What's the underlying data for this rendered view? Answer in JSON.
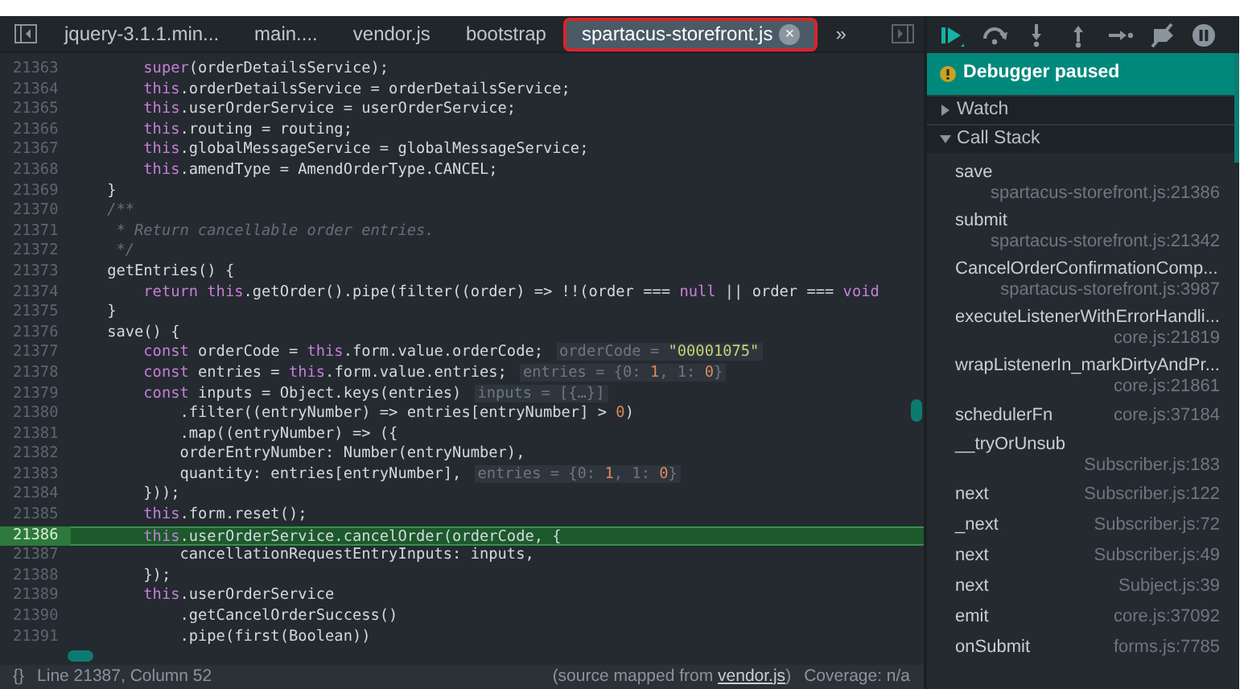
{
  "tabs": [
    {
      "label": "jquery-3.1.1.min...",
      "selected": false
    },
    {
      "label": "main....",
      "selected": false
    },
    {
      "label": "vendor.js",
      "selected": false
    },
    {
      "label": "bootstrap",
      "selected": false
    },
    {
      "label": "spartacus-storefront.js",
      "selected": true,
      "close": "×"
    }
  ],
  "tabs_overflow": "»",
  "code": {
    "lines": [
      {
        "number": "21363",
        "highlighted": false,
        "segments": [
          {
            "kind": "kw",
            "text": "        super"
          },
          {
            "kind": "plain",
            "text": "(orderDetailsService);"
          }
        ]
      },
      {
        "number": "21364",
        "highlighted": false,
        "segments": [
          {
            "kind": "kw",
            "text": "        this"
          },
          {
            "kind": "plain",
            "text": ".orderDetailsService = orderDetailsService;"
          }
        ]
      },
      {
        "number": "21365",
        "highlighted": false,
        "segments": [
          {
            "kind": "kw",
            "text": "        this"
          },
          {
            "kind": "plain",
            "text": ".userOrderService = userOrderService;"
          }
        ]
      },
      {
        "number": "21366",
        "highlighted": false,
        "segments": [
          {
            "kind": "kw",
            "text": "        this"
          },
          {
            "kind": "plain",
            "text": ".routing = routing;"
          }
        ]
      },
      {
        "number": "21367",
        "highlighted": false,
        "segments": [
          {
            "kind": "kw",
            "text": "        this"
          },
          {
            "kind": "plain",
            "text": ".globalMessageService = globalMessageService;"
          }
        ]
      },
      {
        "number": "21368",
        "highlighted": false,
        "segments": [
          {
            "kind": "kw",
            "text": "        this"
          },
          {
            "kind": "plain",
            "text": ".amendType = AmendOrderType.CANCEL;"
          }
        ]
      },
      {
        "number": "21369",
        "highlighted": false,
        "segments": [
          {
            "kind": "plain",
            "text": "    }"
          }
        ]
      },
      {
        "number": "21370",
        "highlighted": false,
        "segments": [
          {
            "kind": "comment",
            "text": "    /**"
          }
        ]
      },
      {
        "number": "21371",
        "highlighted": false,
        "segments": [
          {
            "kind": "comment",
            "text": "     * Return cancellable order entries."
          }
        ]
      },
      {
        "number": "21372",
        "highlighted": false,
        "segments": [
          {
            "kind": "comment",
            "text": "     */"
          }
        ]
      },
      {
        "number": "21373",
        "highlighted": false,
        "segments": [
          {
            "kind": "plain",
            "text": "    getEntries() {"
          }
        ]
      },
      {
        "number": "21374",
        "highlighted": false,
        "segments": [
          {
            "kind": "kw",
            "text": "        return this"
          },
          {
            "kind": "plain",
            "text": ".getOrder().pipe(filter((order) => !!(order === "
          },
          {
            "kind": "kw",
            "text": "null"
          },
          {
            "kind": "plain",
            "text": " || order === "
          },
          {
            "kind": "kw",
            "text": "void"
          }
        ]
      },
      {
        "number": "21375",
        "highlighted": false,
        "segments": [
          {
            "kind": "plain",
            "text": "    }"
          }
        ]
      },
      {
        "number": "21376",
        "highlighted": false,
        "segments": [
          {
            "kind": "plain",
            "text": "    save() {"
          }
        ]
      },
      {
        "number": "21377",
        "highlighted": false,
        "segments": [
          {
            "kind": "kw",
            "text": "        const"
          },
          {
            "kind": "plain",
            "text": " orderCode = "
          },
          {
            "kind": "kw",
            "text": "this"
          },
          {
            "kind": "plain",
            "text": ".form.value.orderCode;"
          }
        ],
        "inline_value": [
          {
            "kind": "hint",
            "text": "orderCode = "
          },
          {
            "kind": "str",
            "text": "\"00001075\""
          }
        ]
      },
      {
        "number": "21378",
        "highlighted": false,
        "segments": [
          {
            "kind": "kw",
            "text": "        const"
          },
          {
            "kind": "plain",
            "text": " entries = "
          },
          {
            "kind": "kw",
            "text": "this"
          },
          {
            "kind": "plain",
            "text": ".form.value.entries;"
          }
        ],
        "inline_value": [
          {
            "kind": "hint",
            "text": "entries = {0: "
          },
          {
            "kind": "num",
            "text": "1"
          },
          {
            "kind": "hint",
            "text": ", 1: "
          },
          {
            "kind": "num",
            "text": "0"
          },
          {
            "kind": "hint",
            "text": "}"
          }
        ]
      },
      {
        "number": "21379",
        "highlighted": false,
        "segments": [
          {
            "kind": "kw",
            "text": "        const"
          },
          {
            "kind": "plain",
            "text": " inputs = Object.keys(entries)"
          }
        ],
        "inline_value": [
          {
            "kind": "hint",
            "text": "inputs = [{…}]"
          }
        ]
      },
      {
        "number": "21380",
        "highlighted": false,
        "segments": [
          {
            "kind": "plain",
            "text": "            .filter((entryNumber) => entries[entryNumber] > "
          },
          {
            "kind": "num",
            "text": "0"
          },
          {
            "kind": "plain",
            "text": ")"
          }
        ]
      },
      {
        "number": "21381",
        "highlighted": false,
        "segments": [
          {
            "kind": "plain",
            "text": "            .map((entryNumber) => ({"
          }
        ]
      },
      {
        "number": "21382",
        "highlighted": false,
        "segments": [
          {
            "kind": "plain",
            "text": "            orderEntryNumber: Number(entryNumber),"
          }
        ]
      },
      {
        "number": "21383",
        "highlighted": false,
        "segments": [
          {
            "kind": "plain",
            "text": "            quantity: entries[entryNumber],"
          }
        ],
        "inline_value": [
          {
            "kind": "hint",
            "text": "entries = {0: "
          },
          {
            "kind": "num",
            "text": "1"
          },
          {
            "kind": "hint",
            "text": ", 1: "
          },
          {
            "kind": "num",
            "text": "0"
          },
          {
            "kind": "hint",
            "text": "}"
          }
        ]
      },
      {
        "number": "21384",
        "highlighted": false,
        "segments": [
          {
            "kind": "plain",
            "text": "        }));"
          }
        ]
      },
      {
        "number": "21385",
        "highlighted": false,
        "segments": [
          {
            "kind": "kw",
            "text": "        this"
          },
          {
            "kind": "plain",
            "text": ".form.reset();"
          }
        ]
      },
      {
        "number": "21386",
        "highlighted": true,
        "segments": [
          {
            "kind": "kw",
            "text": "        this"
          },
          {
            "kind": "plain",
            "text": ".userOrderService.cancelOrder(orderCode, {"
          }
        ]
      },
      {
        "number": "21387",
        "highlighted": false,
        "segments": [
          {
            "kind": "plain",
            "text": "            cancellationRequestEntryInputs: inputs,"
          }
        ]
      },
      {
        "number": "21388",
        "highlighted": false,
        "segments": [
          {
            "kind": "plain",
            "text": "        });"
          }
        ]
      },
      {
        "number": "21389",
        "highlighted": false,
        "segments": [
          {
            "kind": "kw",
            "text": "        this"
          },
          {
            "kind": "plain",
            "text": ".userOrderService"
          }
        ]
      },
      {
        "number": "21390",
        "highlighted": false,
        "segments": [
          {
            "kind": "plain",
            "text": "            .getCancelOrderSuccess()"
          }
        ]
      },
      {
        "number": "21391",
        "highlighted": false,
        "segments": [
          {
            "kind": "plain",
            "text": "            .pipe(first(Boolean))"
          }
        ]
      }
    ]
  },
  "status_bar": {
    "format_icon": "{}",
    "position": "Line 21387, Column 52",
    "source_prefix": "(source mapped from ",
    "source_link": "vendor.js",
    "source_suffix": ")",
    "coverage": "Coverage: n/a"
  },
  "debugger": {
    "banner": "Debugger paused",
    "sections": [
      {
        "title": "Watch",
        "expanded": false
      },
      {
        "title": "Call Stack",
        "expanded": true
      }
    ],
    "call_stack": [
      {
        "kind": "wrapped",
        "name": "save",
        "location": "spartacus-storefront.js:21386"
      },
      {
        "kind": "wrapped",
        "name": "submit",
        "location": "spartacus-storefront.js:21342"
      },
      {
        "kind": "wrapped",
        "name": "CancelOrderConfirmationComp...",
        "location": "spartacus-storefront.js:3987"
      },
      {
        "kind": "wrapped",
        "name": "executeListenerWithErrorHandli...",
        "location": "core.js:21819"
      },
      {
        "kind": "wrapped",
        "name": "wrapListenerIn_markDirtyAndPr...",
        "location": "core.js:21861"
      },
      {
        "kind": "inline",
        "name": "schedulerFn",
        "location": "core.js:37184"
      },
      {
        "kind": "wrapped",
        "name": "__tryOrUnsub",
        "location": "Subscriber.js:183"
      },
      {
        "kind": "inline",
        "name": "next",
        "location": "Subscriber.js:122"
      },
      {
        "kind": "inline",
        "name": "_next",
        "location": "Subscriber.js:72"
      },
      {
        "kind": "inline",
        "name": "next",
        "location": "Subscriber.js:49"
      },
      {
        "kind": "inline",
        "name": "next",
        "location": "Subject.js:39"
      },
      {
        "kind": "inline",
        "name": "emit",
        "location": "core.js:37092"
      },
      {
        "kind": "inline",
        "name": "onSubmit",
        "location": "forms.js:7785"
      }
    ]
  }
}
